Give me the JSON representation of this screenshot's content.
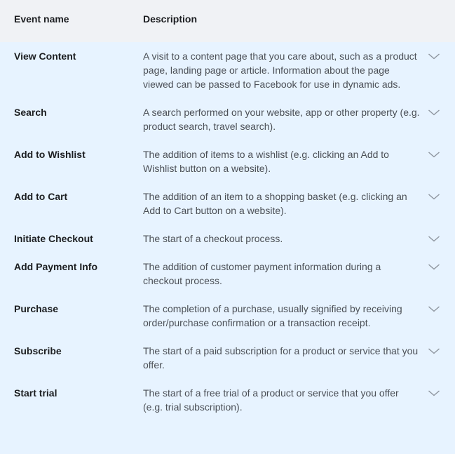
{
  "header": {
    "event_name_label": "Event name",
    "description_label": "Description"
  },
  "rows": [
    {
      "name": "View Content",
      "description": "A visit to a content page that you care about, such as a product page, landing page or article. Information about the page viewed can be passed to Facebook for use in dynamic ads.",
      "icon": "chevron-down-icon"
    },
    {
      "name": "Search",
      "description": "A search performed on your website, app or other property (e.g. product search, travel search).",
      "icon": "chevron-down-icon"
    },
    {
      "name": "Add to Wishlist",
      "description": "The addition of items to a wishlist (e.g. clicking an Add to Wishlist button on a website).",
      "icon": "chevron-down-icon"
    },
    {
      "name": "Add to Cart",
      "description": "The addition of an item to a shopping basket (e.g. clicking an Add to Cart button on a website).",
      "icon": "chevron-down-icon"
    },
    {
      "name": "Initiate Checkout",
      "description": "The start of a checkout process.",
      "icon": "chevron-down-icon"
    },
    {
      "name": "Add Payment Info",
      "description": "The addition of customer payment information during a checkout process.",
      "icon": "chevron-down-icon"
    },
    {
      "name": "Purchase",
      "description": "The completion of a purchase, usually signified by receiving order/purchase confirmation or a transaction receipt.",
      "icon": "chevron-down-icon"
    },
    {
      "name": "Subscribe",
      "description": "The start of a paid subscription for a product or service that you offer.",
      "icon": "chevron-down-icon"
    },
    {
      "name": "Start trial",
      "description": "The start of a free trial of a product or service that you offer (e.g. trial subscription).",
      "icon": "chevron-down-icon"
    }
  ],
  "colors": {
    "header_bg": "#f0f2f5",
    "body_bg": "#e7f3ff",
    "name_text": "#1c1e21",
    "description_text": "#4b4f56",
    "chevron": "#8d949e"
  }
}
